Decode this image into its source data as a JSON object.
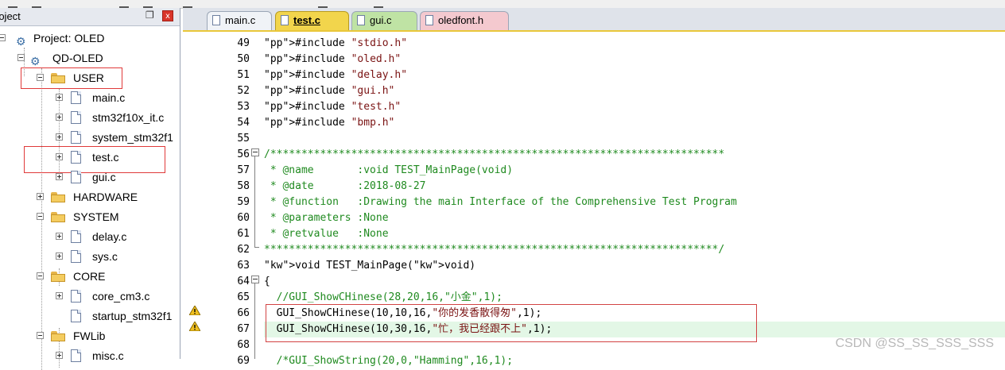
{
  "project_panel": {
    "title": "roject",
    "pin_glyph": "❐",
    "close_glyph": "x",
    "tree": {
      "root": "Project: OLED",
      "target": "QD-OLED",
      "user_folder": "USER",
      "user_files": [
        "main.c",
        "stm32f10x_it.c",
        "system_stm32f1",
        "test.c",
        "gui.c"
      ],
      "folders": [
        "HARDWARE",
        "SYSTEM"
      ],
      "system_files": [
        "delay.c",
        "sys.c"
      ],
      "core_folder": "CORE",
      "core_files": [
        "core_cm3.c",
        "startup_stm32f1"
      ],
      "fwlib_folder": "FWLib",
      "fwlib_files": [
        "misc.c"
      ]
    }
  },
  "editor": {
    "tabs": [
      {
        "label": "main.c",
        "active": false
      },
      {
        "label": "test.c",
        "active": true
      },
      {
        "label": "gui.c",
        "active": false
      },
      {
        "label": "oledfont.h",
        "active": false
      }
    ],
    "lines": [
      {
        "num": "49",
        "text": "#include \"stdio.h\""
      },
      {
        "num": "50",
        "text": "#include \"oled.h\""
      },
      {
        "num": "51",
        "text": "#include \"delay.h\""
      },
      {
        "num": "52",
        "text": "#include \"gui.h\""
      },
      {
        "num": "53",
        "text": "#include \"test.h\""
      },
      {
        "num": "54",
        "text": "#include \"bmp.h\""
      },
      {
        "num": "55",
        "text": ""
      },
      {
        "num": "56",
        "text": "/*************************************************************************"
      },
      {
        "num": "57",
        "text": " * @name       :void TEST_MainPage(void)"
      },
      {
        "num": "58",
        "text": " * @date       :2018-08-27"
      },
      {
        "num": "59",
        "text": " * @function   :Drawing the main Interface of the Comprehensive Test Program"
      },
      {
        "num": "60",
        "text": " * @parameters :None"
      },
      {
        "num": "61",
        "text": " * @retvalue   :None"
      },
      {
        "num": "62",
        "text": "*************************************************************************/"
      },
      {
        "num": "63",
        "text": "void TEST_MainPage(void)"
      },
      {
        "num": "64",
        "text": "{"
      },
      {
        "num": "65",
        "text": "  //GUI_ShowCHinese(28,20,16,\"小金\",1);"
      },
      {
        "num": "66",
        "text": "  GUI_ShowCHinese(10,10,16,\"你的发香散得匆\",1);"
      },
      {
        "num": "67",
        "text": "  GUI_ShowCHinese(10,30,16,\"忙，我已经跟不上\",1);"
      },
      {
        "num": "68",
        "text": ""
      },
      {
        "num": "69",
        "text": "  /*GUI_ShowString(20,0,\"Hamming\",16,1);"
      }
    ],
    "warning_icon": "warning-triangle"
  },
  "watermark": "CSDN @SS_SS_SSS_SSS"
}
